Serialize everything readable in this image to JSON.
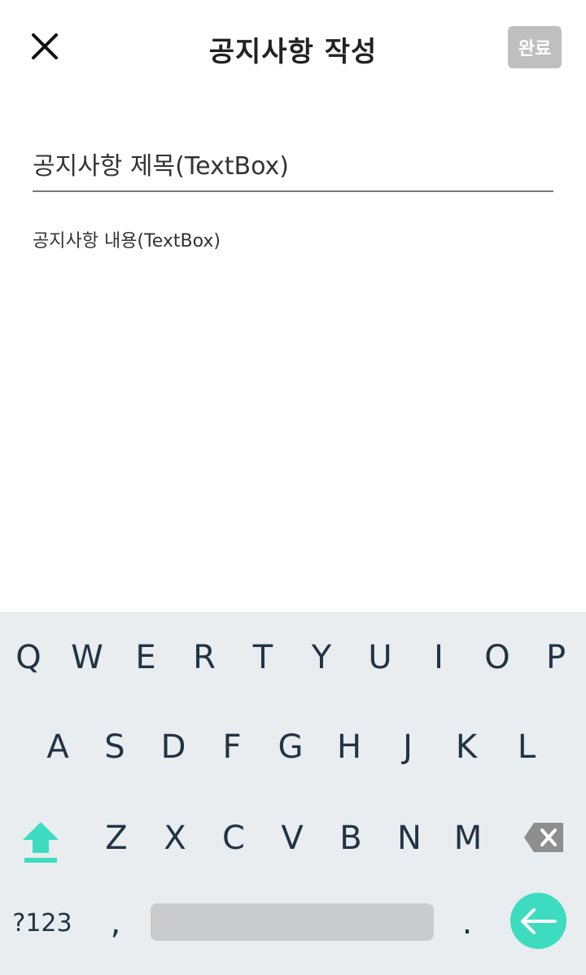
{
  "header": {
    "title": "공지사항 작성",
    "done_label": "완료",
    "close_icon": "close-icon"
  },
  "form": {
    "title_placeholder": "공지사항 제목(TextBox)",
    "title_value": "",
    "content_placeholder": "공지사항 내용(TextBox)",
    "content_value": ""
  },
  "keyboard": {
    "row1": [
      "Q",
      "W",
      "E",
      "R",
      "T",
      "Y",
      "U",
      "I",
      "O",
      "P"
    ],
    "row2": [
      "A",
      "S",
      "D",
      "F",
      "G",
      "H",
      "J",
      "K",
      "L"
    ],
    "row3": [
      "Z",
      "X",
      "C",
      "V",
      "B",
      "N",
      "M"
    ],
    "symbols_label": "?123",
    "comma_label": ",",
    "period_label": ".",
    "shift_icon": "shift-icon",
    "backspace_icon": "backspace-icon",
    "enter_icon": "enter-arrow-icon"
  },
  "colors": {
    "accent": "#3ddcc0",
    "done_button_bg": "#bfbfbf",
    "keyboard_bg": "#e9edf0",
    "key_text": "#223344"
  }
}
